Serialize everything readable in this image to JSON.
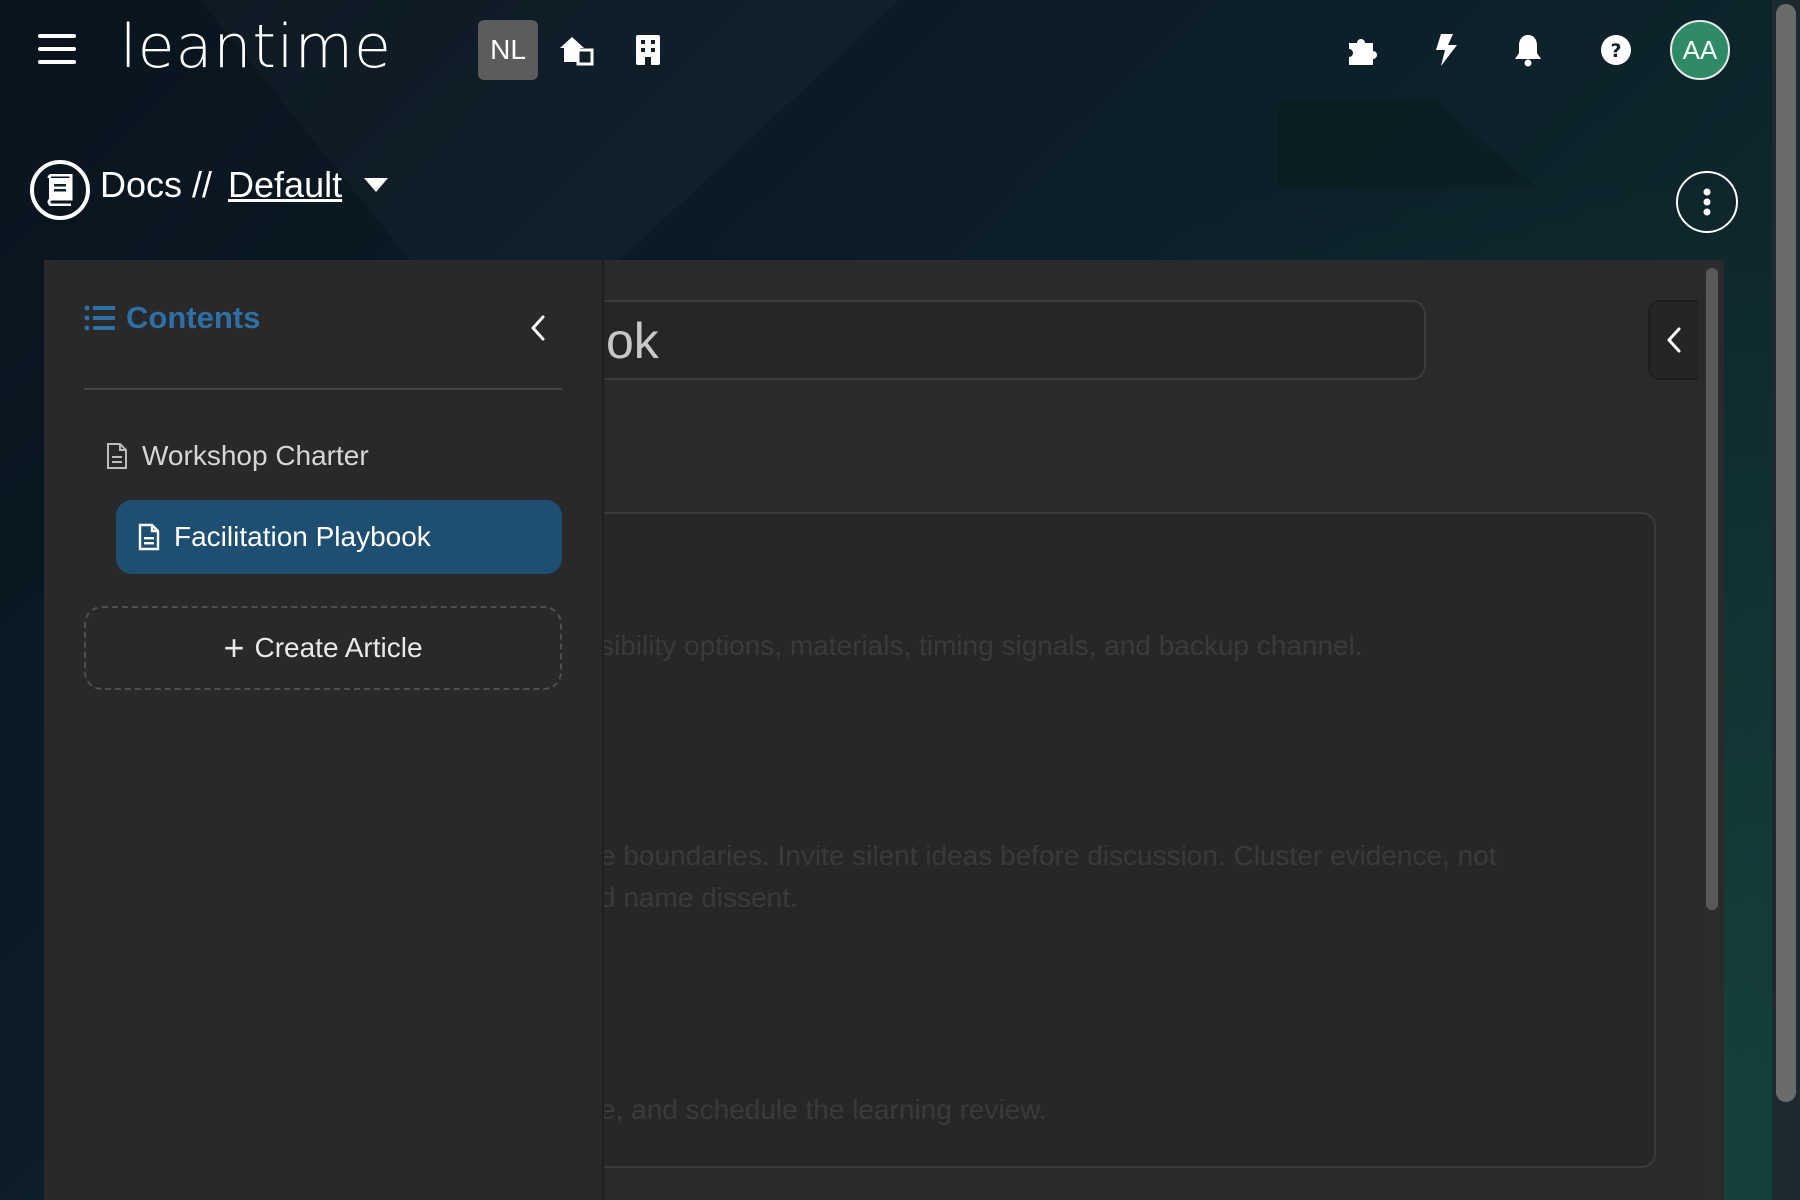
{
  "header": {
    "logo": "leantime",
    "project_badge": "NL",
    "avatar_initials": "AA"
  },
  "breadcrumb": {
    "section": "Docs //",
    "current": "Default"
  },
  "sidebar": {
    "title": "Contents",
    "items": [
      {
        "label": "Workshop Charter",
        "active": false
      },
      {
        "label": "Facilitation Playbook",
        "active": true
      }
    ],
    "create_label": "Create Article"
  },
  "main": {
    "title_value": "ok",
    "ghost_lines": [
      "sibility options, materials, timing signals, and backup channel.",
      "e boundaries. Invite silent ideas before discussion. Cluster evidence, not",
      "d name dissent.",
      "e, and schedule the learning review."
    ]
  },
  "colors": {
    "accent": "#2e6fa6",
    "active_item": "#1f4e73",
    "avatar": "#2f8b66"
  }
}
